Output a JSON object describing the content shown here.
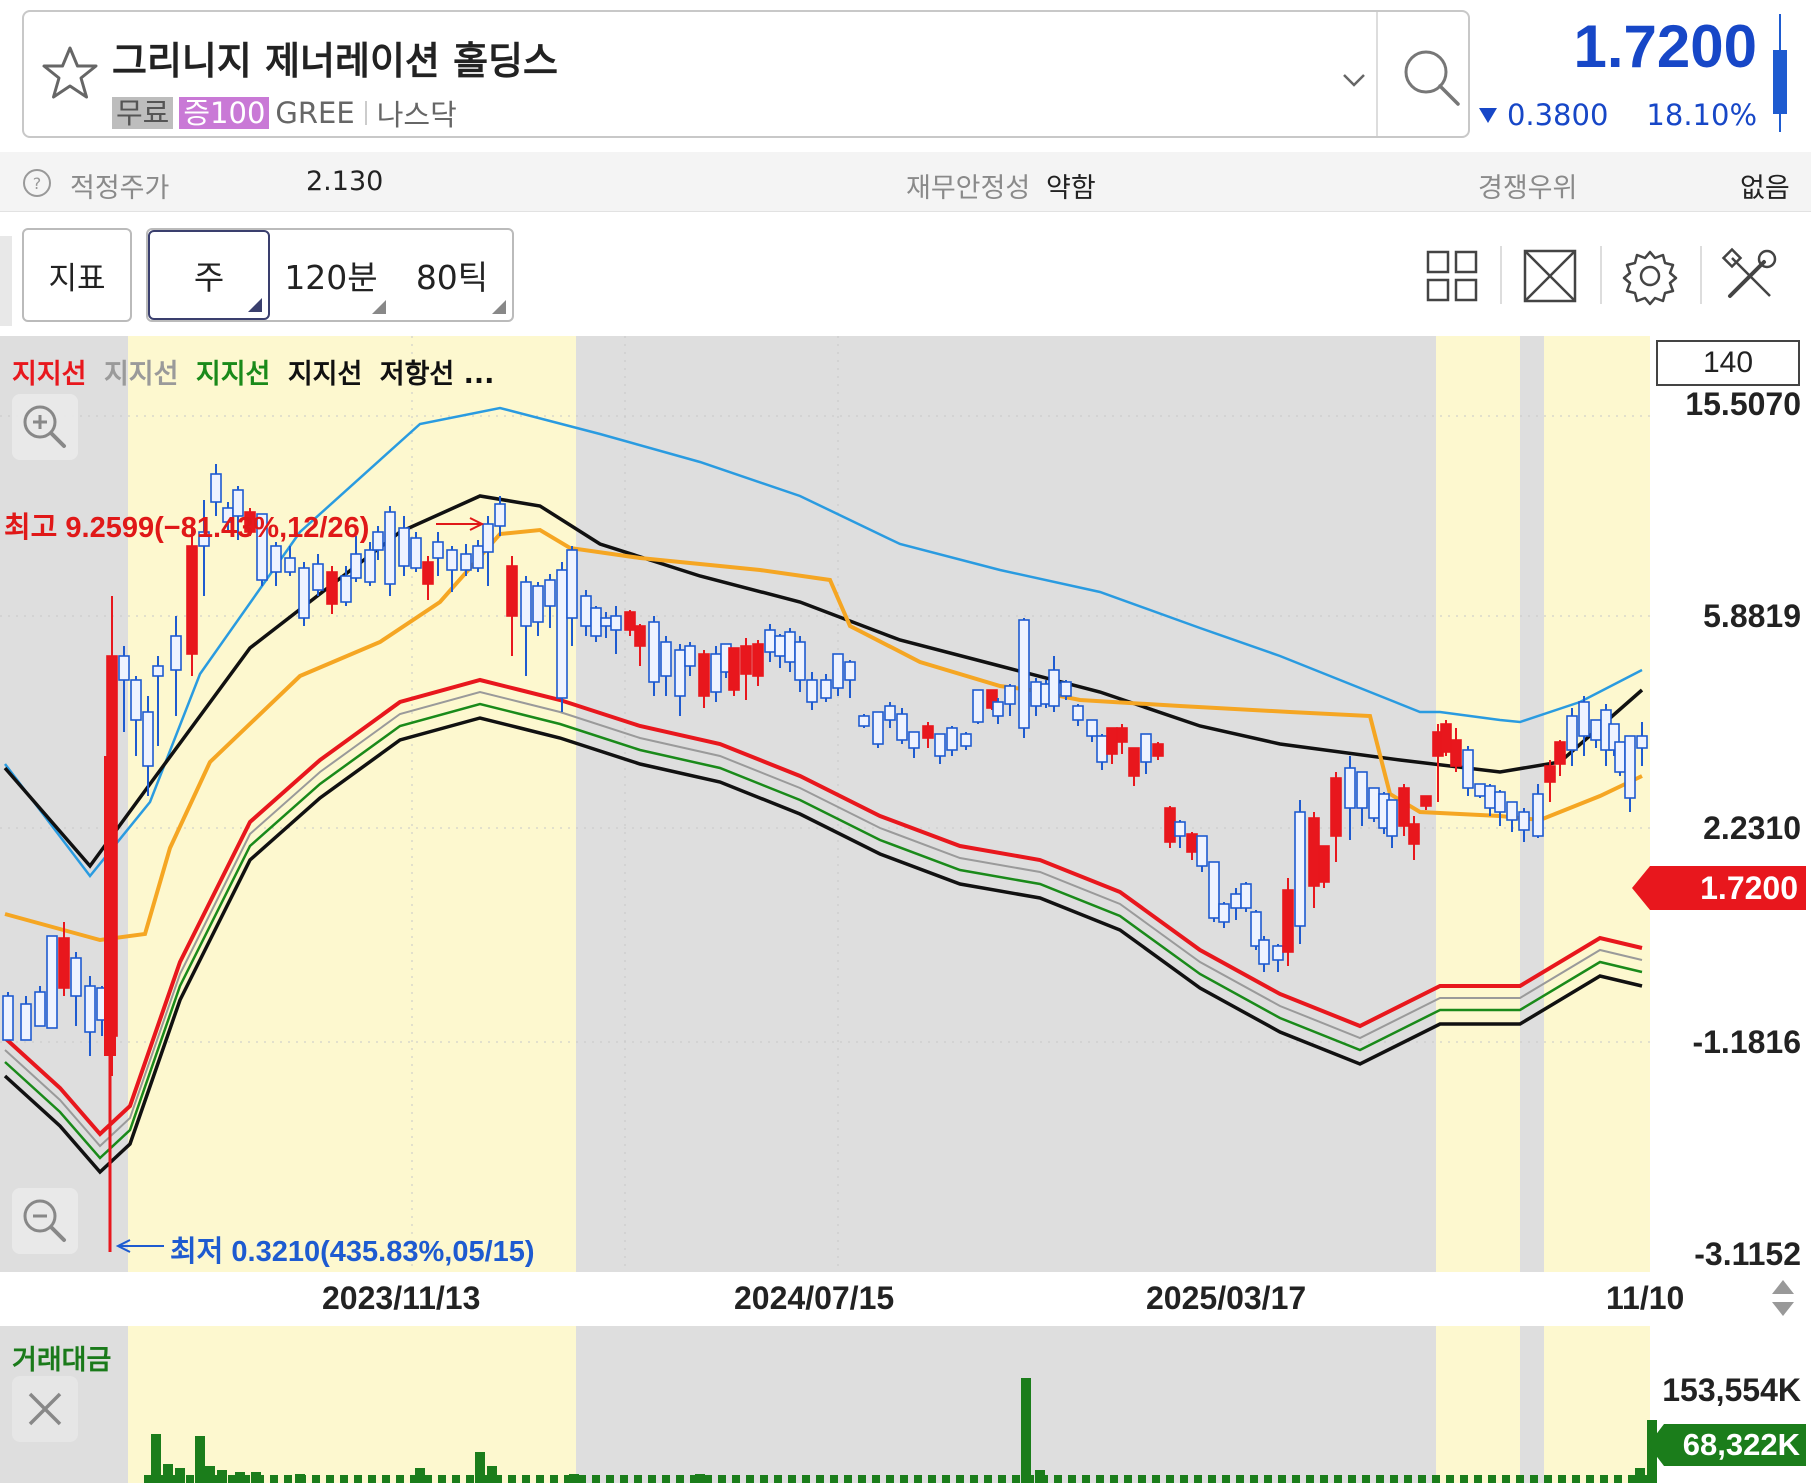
{
  "header": {
    "stock_name": "그리니지 제너레이션 홀딩스",
    "tags": {
      "free": "무료",
      "margin": "증100",
      "ticker": "GREE",
      "market": "나스닥"
    },
    "price": "1.7200",
    "change": "0.3800",
    "change_pct": "18.10%",
    "icons": [
      "star-icon",
      "chevron-down-icon",
      "search-icon"
    ]
  },
  "info": {
    "fair_price_label": "적정주가",
    "fair_price_value": "2.130",
    "stability_label": "재무안정성",
    "stability_value": "약함",
    "competitive_label": "경쟁우위",
    "competitive_value": "없음"
  },
  "toolbar": {
    "indicator": "지표",
    "periods": [
      "주",
      "120분",
      "80틱"
    ],
    "selected_period": "주",
    "icons": [
      "layout-grid-icon",
      "fullscreen-icon",
      "settings-icon",
      "tools-icon"
    ]
  },
  "legend": {
    "items": [
      {
        "label": "지지선",
        "color": "#e8171d"
      },
      {
        "label": "지지선",
        "color": "#9a9a9a"
      },
      {
        "label": "지지선",
        "color": "#1a8a1a"
      },
      {
        "label": "지지선",
        "color": "#111111"
      },
      {
        "label": "저항선 ...",
        "color": "#111111"
      }
    ]
  },
  "chart": {
    "period_count": "140",
    "y_labels": [
      "15.5070",
      "5.8819",
      "2.2310",
      "-1.1816",
      "-3.1152"
    ],
    "current_price_tag": "1.7200",
    "high_annotation": "최고 9.2599(−81.43%,12/26)",
    "low_annotation": "최저 0.3210(435.83%,05/15)",
    "dates": [
      "2023/11/13",
      "2024/07/15",
      "2025/03/17",
      "11/10"
    ],
    "colors": {
      "up": "#e8171d",
      "down": "#1e5bd0",
      "upper_band": "#2a9be0",
      "resistance": "#f5a623",
      "volume": "#1b7d1b"
    }
  },
  "volume": {
    "title": "거래대금",
    "max_label": "153,554K",
    "current_tag": "68,322K"
  },
  "chart_data": {
    "type": "line",
    "title": "",
    "x_ticks": [
      "2023/11/13",
      "2024/07/15",
      "2025/03/17",
      "11/10"
    ],
    "y_ticks": [
      15.507,
      5.8819,
      2.231,
      -1.1816,
      -3.1152
    ],
    "series": [
      {
        "name": "지지선",
        "color": "#e8171d"
      },
      {
        "name": "지지선",
        "color": "#9a9a9a"
      },
      {
        "name": "지지선",
        "color": "#1a8a1a"
      },
      {
        "name": "지지선",
        "color": "#111111"
      },
      {
        "name": "저항선",
        "color": "#111111"
      }
    ],
    "high": {
      "value": 9.2599,
      "date": "12/26"
    },
    "low": {
      "value": 0.321,
      "date": "05/15"
    },
    "last_price": 1.72
  }
}
